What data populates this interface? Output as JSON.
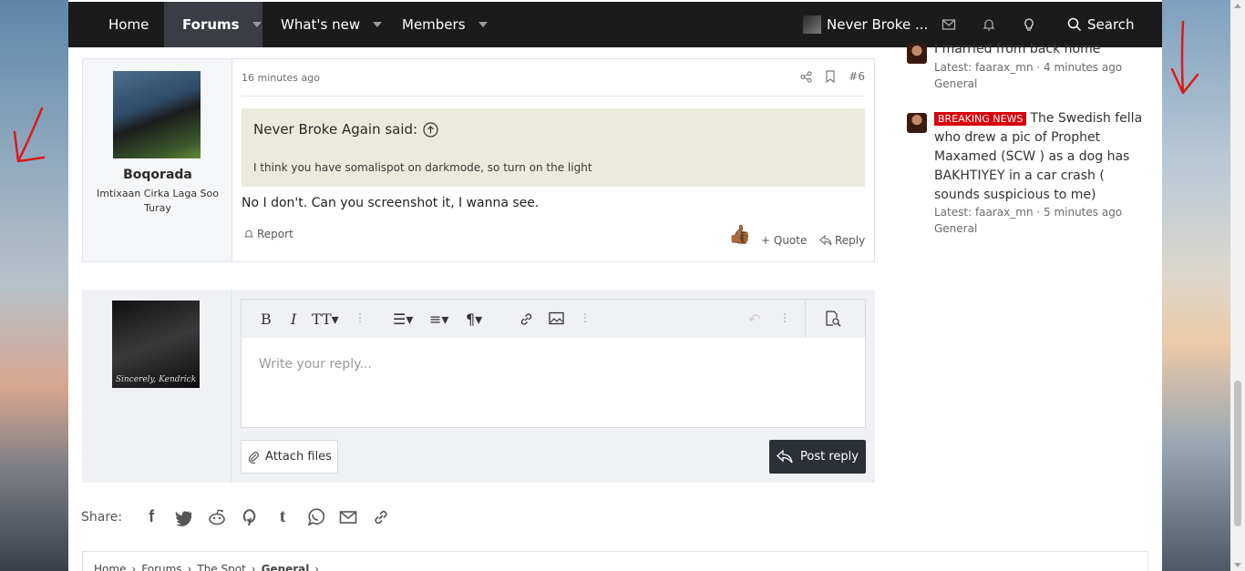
{
  "nav": {
    "home": "Home",
    "forums": "Forums",
    "whats_new": "What's new",
    "members": "Members",
    "username": "Never Broke ...",
    "search": "Search"
  },
  "post": {
    "time": "16 minutes ago",
    "number": "#6",
    "author": "Boqorada",
    "author_title": "Imtixaan Cirka Laga Soo Turay",
    "quote_author": "Never Broke Again said:",
    "quote_text": "I think you have somalispot on darkmode, so turn on the light",
    "body": "No I don't. Can you screenshot it, I wanna see.",
    "report": "Report",
    "quote": "Quote",
    "reply": "Reply"
  },
  "reply_box": {
    "placeholder": "Write your reply...",
    "attach": "Attach files",
    "post_reply": "Post reply",
    "avatar_caption": "Sincerely, Kendrick"
  },
  "share": {
    "label": "Share:"
  },
  "breadcrumb": [
    "Home",
    "Forums",
    "The Spot",
    "General"
  ],
  "sidebar": {
    "items": [
      {
        "title": "I married from back home",
        "meta": "Latest: faarax_mn · 4 minutes ago",
        "forum": "General"
      },
      {
        "badge": "BREAKING NEWS",
        "title": "The Swedish fella who drew a pic of Prophet Maxamed (SCW ) as a dog has BAKHTIYEY in a car crash ( sounds suspicious to me)",
        "meta": "Latest: faarax_mn · 5 minutes ago",
        "forum": "General"
      }
    ]
  },
  "colors": {
    "navbar": "#1b1b1b",
    "active_tab": "#3a3d43",
    "quote_bg": "#ebeadc",
    "post_reply_bg": "#2b2f36",
    "breaking_badge": "#d8000c",
    "annotation_arrow": "#d81b1b"
  }
}
